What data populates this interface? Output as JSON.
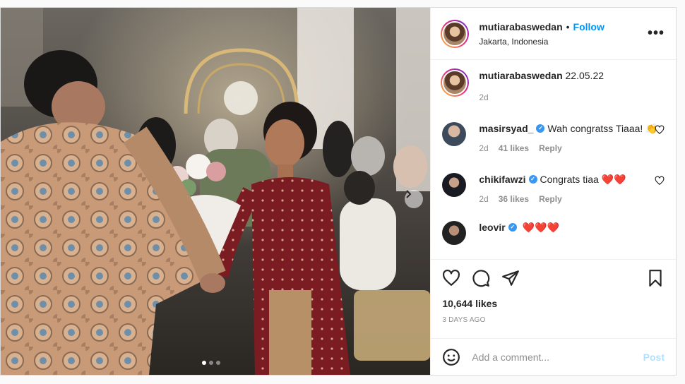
{
  "post": {
    "author": "mutiarabaswedan",
    "follow_label": "Follow",
    "separator": "•",
    "location": "Jakarta, Indonesia",
    "more_label": "•••"
  },
  "caption": {
    "username": "mutiarabaswedan",
    "text": "22.05.22",
    "time": "2d"
  },
  "comments": [
    {
      "username": "masirsyad_",
      "verified": true,
      "text": "Wah congratss Tiaaa!",
      "emoji": "👏",
      "time": "2d",
      "likes": "41 likes",
      "reply": "Reply"
    },
    {
      "username": "chikifawzi",
      "verified": true,
      "text": "Congrats tiaa",
      "emoji": "❤️❤️",
      "time": "2d",
      "likes": "36 likes",
      "reply": "Reply"
    },
    {
      "username": "leovir",
      "verified": true,
      "text": "",
      "emoji": "❤️❤️❤️",
      "time": "",
      "likes": "",
      "reply": ""
    }
  ],
  "stats": {
    "likes": "10,644 likes",
    "date": "3 DAYS AGO"
  },
  "add_comment": {
    "placeholder": "Add a comment...",
    "post_label": "Post"
  },
  "carousel": {
    "count": 3,
    "active": 0
  },
  "colors": {
    "follow": "#0095f6",
    "verified": "#3897f0",
    "post_disabled": "#b2dffc",
    "heart": "#ed4956"
  }
}
